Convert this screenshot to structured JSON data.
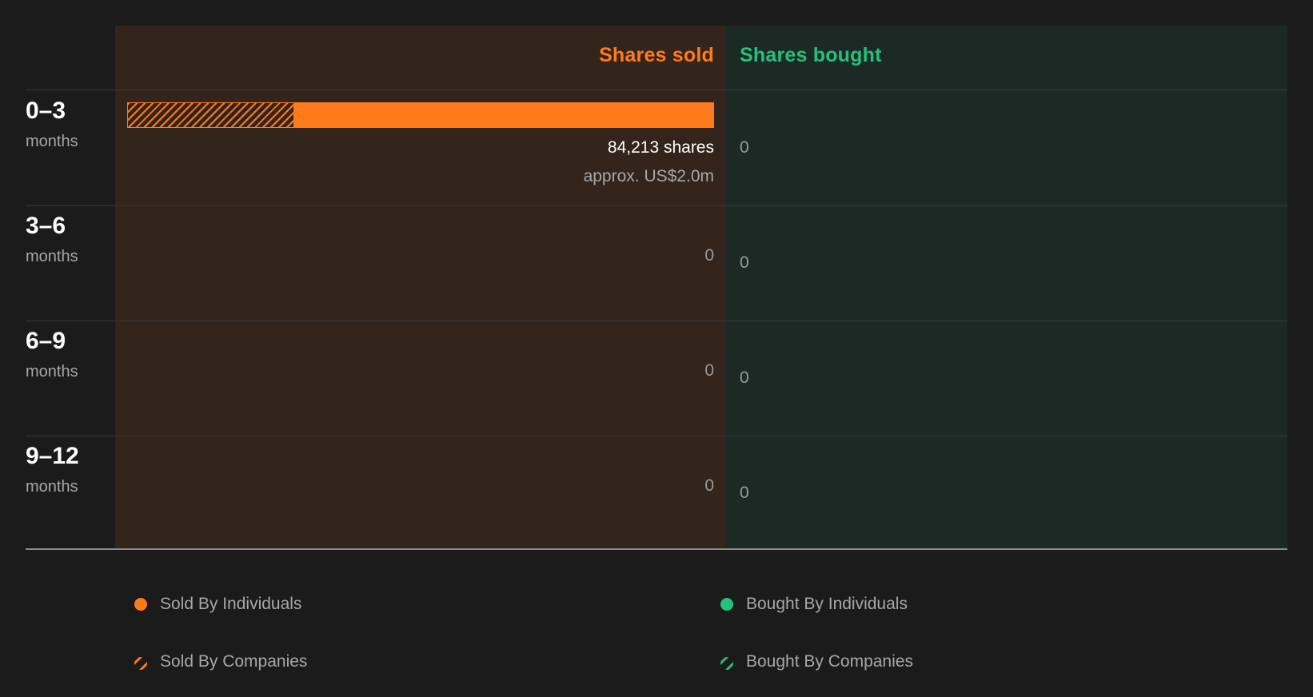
{
  "colors": {
    "background": "#1b1b1b",
    "sold": "#ff7a1a",
    "bought": "#25c07a",
    "sold_panel": "#33241c",
    "bought_panel": "#1c2a25"
  },
  "chart_data": {
    "type": "bar",
    "orientation": "horizontal-diverging",
    "header_sold": "Shares sold",
    "header_bought": "Shares bought",
    "unit_label": "months",
    "categories": [
      "0–3",
      "3–6",
      "6–9",
      "9–12"
    ],
    "sold": {
      "total_labels": [
        "84,213 shares",
        "0",
        "0",
        "0"
      ],
      "approx_labels": [
        "approx. US$2.0m",
        "",
        "",
        ""
      ],
      "values": [
        84213,
        0,
        0,
        0
      ],
      "individual_fraction": [
        0.715,
        0,
        0,
        0
      ],
      "company_fraction": [
        0.285,
        0,
        0,
        0
      ]
    },
    "bought": {
      "total_labels": [
        "0",
        "0",
        "0",
        "0"
      ],
      "values": [
        0,
        0,
        0,
        0
      ]
    },
    "legend": {
      "sold_individuals": "Sold By Individuals",
      "sold_companies": "Sold By Companies",
      "bought_individuals": "Bought By Individuals",
      "bought_companies": "Bought By Companies"
    },
    "legend_placement": "bottom",
    "grid": false
  }
}
